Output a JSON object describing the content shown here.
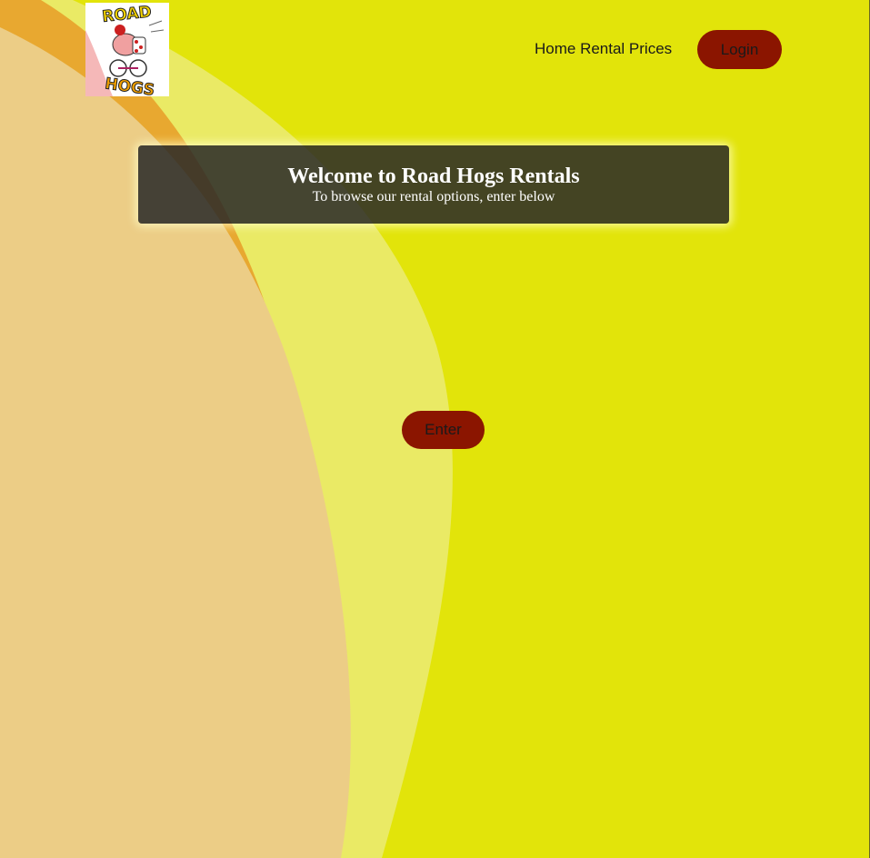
{
  "header": {
    "logo_text_top": "ROAD",
    "logo_text_bottom": "HOGS",
    "nav_link_label": "Home Rental Prices",
    "login_label": "Login"
  },
  "hero": {
    "title": "Welcome to Road Hogs Rentals",
    "subtitle": "To browse our rental options, enter below"
  },
  "main": {
    "enter_label": "Enter"
  },
  "colors": {
    "background": "#e2e40a",
    "wave_orange": "#e8a830",
    "wave_peach": "#eccd86",
    "wave_light": "#ebeb75",
    "button": "#8b1500"
  }
}
